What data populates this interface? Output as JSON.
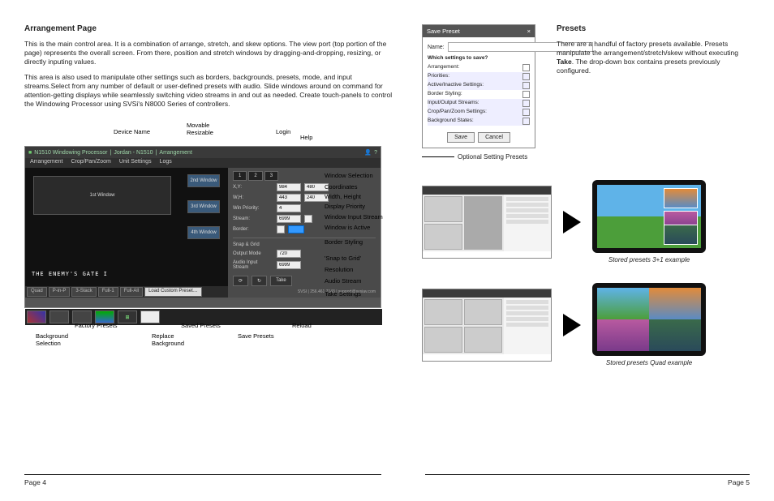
{
  "left": {
    "heading": "Arrangement Page",
    "para1": "This is the main control area. It is a combination of arrange, stretch, and skew options. The view port (top portion of the page) represents the overall screen. From there, position and stretch windows by dragging-and-dropping, resizing, or directly inputing values.",
    "para2": "This area is also used to manipulate other settings such as borders, backgrounds, presets, mode, and input streams.Select from any number of default or user-defined presets with audio. Slide windows around on command for attention-getting displays while seamlessly switching video streams in and out as needed. Create touch-panels to control the Windowing Processor using SVSi's N8000 Series of controllers.",
    "app": {
      "title_prefix": "N1510 Windowing Processor",
      "title_mid": "Jordan - N1510",
      "title_suf": "Arrangement",
      "menu": {
        "arrangement": "Arrangement",
        "crop": "Crop/Pan/Zoom",
        "unit": "Unit Settings",
        "logs": "Logs"
      },
      "windows": {
        "w1": "1st Window",
        "w2": "2nd Window",
        "w3": "3rd Window",
        "w4": "4th Window"
      },
      "banner": "THE ENEMY'S GATE I",
      "presets": {
        "quad": "Quad",
        "pinp": "P-in-P",
        "stack3": "3-Stack",
        "full1": "Full-1",
        "fullall": "Full-All",
        "load": "Load Custom Preset…"
      },
      "side": {
        "tabs": {
          "t1": "1",
          "t2": "2",
          "t3": "3"
        },
        "xy_label": "X,Y:",
        "x": "984",
        "y": "480",
        "wh_label": "W,H:",
        "w": "443",
        "h": "240",
        "prio_label": "Win Priority:",
        "prio": "4",
        "stream_label": "Stream:",
        "stream": "6999",
        "border_label": "Border:",
        "snap_label": "Snap & Grid",
        "outmode_label": "Output Mode",
        "outmode": "720",
        "audio_label": "Audio Input Stream",
        "audio": "6999",
        "btn_save": "⟳",
        "btn_reload": "↻",
        "btn_take": "Take"
      },
      "footer_contact": "SVSI  |  256.461.7143  |  support@svsiav.com"
    },
    "callouts": {
      "device_name": "Device Name",
      "movable": "Movable\nResizable",
      "login": "Login",
      "help": "Help",
      "window_selection": "Window Selection",
      "coordinates": "Coordinates",
      "width_height": "Width, Height",
      "display_priority": "Display Priority",
      "window_input_stream": "Window Input Stream",
      "window_active": "Window is Active",
      "border_styling": "Border Styling",
      "snap": "'Snap to Grid'",
      "resolution": "Resolution",
      "audio_stream": "Audio Stream",
      "take_settings": "Take Settings",
      "reload": "Reload",
      "save_presets": "Save Presets",
      "saved_presets": "Saved Presets",
      "replace_bg": "Replace\nBackground",
      "factory_presets": "Factory Presets",
      "background_selection": "Background\nSelection"
    }
  },
  "right": {
    "heading": "Presets",
    "para_a": "There are a handful of factory presets available. Presets manipulate the arrangement/stretch/skew without executing ",
    "take": "Take",
    "para_b": ". The drop-down box contains presets previously configured.",
    "dlg": {
      "title": "Save Preset",
      "name_label": "Name:",
      "question": "Which settings to save?",
      "opts": {
        "arr": "Arrangement:",
        "prio": "Priorities:",
        "act": "Active/Inactive Settings:",
        "bord": "Border Styling:",
        "io": "Input/Output Streams:",
        "cpz": "Crop/Pan/Zoom Settings:",
        "bg": "Background States:"
      },
      "save": "Save",
      "cancel": "Cancel"
    },
    "opt_label": "Optional Setting Presets",
    "caption1": "Stored presets 3+1 example",
    "caption2": "Stored presets Quad example"
  },
  "footer": {
    "p4": "Page 4",
    "p5": "Page 5"
  }
}
